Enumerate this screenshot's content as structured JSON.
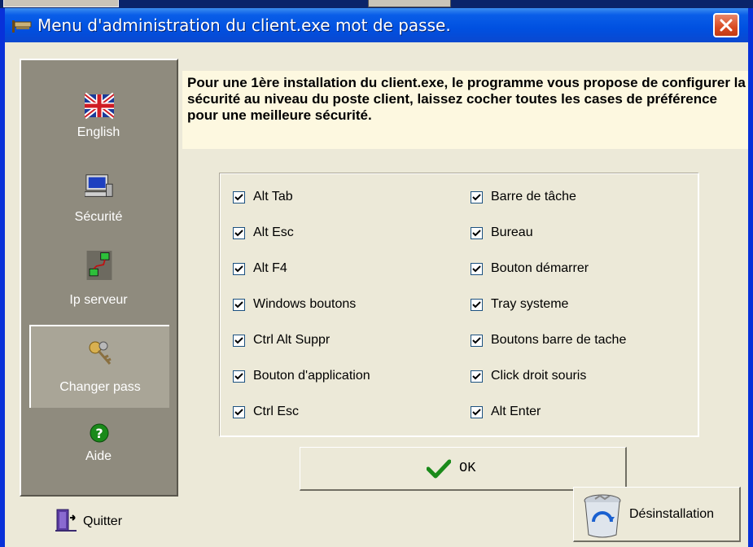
{
  "window": {
    "title": "Menu d'administration  du client.exe mot de passe."
  },
  "sidebar": {
    "items": [
      {
        "label": "English",
        "icon": "uk-flag-icon"
      },
      {
        "label": "Sécurité",
        "icon": "computer-lock-icon"
      },
      {
        "label": "Ip serveur",
        "icon": "network-icon"
      },
      {
        "label": "Changer pass",
        "icon": "keys-icon",
        "selected": true
      },
      {
        "label": "Aide",
        "icon": "help-icon"
      }
    ]
  },
  "info": {
    "text": "Pour une 1ère installation du client.exe, le programme vous propose de configurer la sécurité au niveau du poste client, laissez cocher toutes les cases de préférence pour une meilleure sécurité."
  },
  "options": {
    "left": [
      {
        "label": "Alt Tab",
        "checked": true
      },
      {
        "label": "Alt Esc",
        "checked": true
      },
      {
        "label": "Alt F4",
        "checked": true
      },
      {
        "label": "Windows boutons",
        "checked": true
      },
      {
        "label": "Ctrl Alt Suppr",
        "checked": true
      },
      {
        "label": "Bouton d'application",
        "checked": true
      },
      {
        "label": "Ctrl Esc",
        "checked": true
      }
    ],
    "right": [
      {
        "label": "Barre de tâche",
        "checked": true
      },
      {
        "label": "Bureau",
        "checked": true
      },
      {
        "label": "Bouton démarrer",
        "checked": true
      },
      {
        "label": "Tray systeme",
        "checked": true
      },
      {
        "label": "Boutons barre de tache",
        "checked": true
      },
      {
        "label": "Click droit souris",
        "checked": true
      },
      {
        "label": "Alt Enter",
        "checked": true
      }
    ]
  },
  "buttons": {
    "ok": "OK",
    "quit": "Quitter",
    "uninstall": "Désinstallation"
  },
  "colors": {
    "titlebar": "#0054e3",
    "sidebar": "#8f8b7e",
    "info_bg": "#fdf8e0",
    "close": "#d94a22"
  }
}
